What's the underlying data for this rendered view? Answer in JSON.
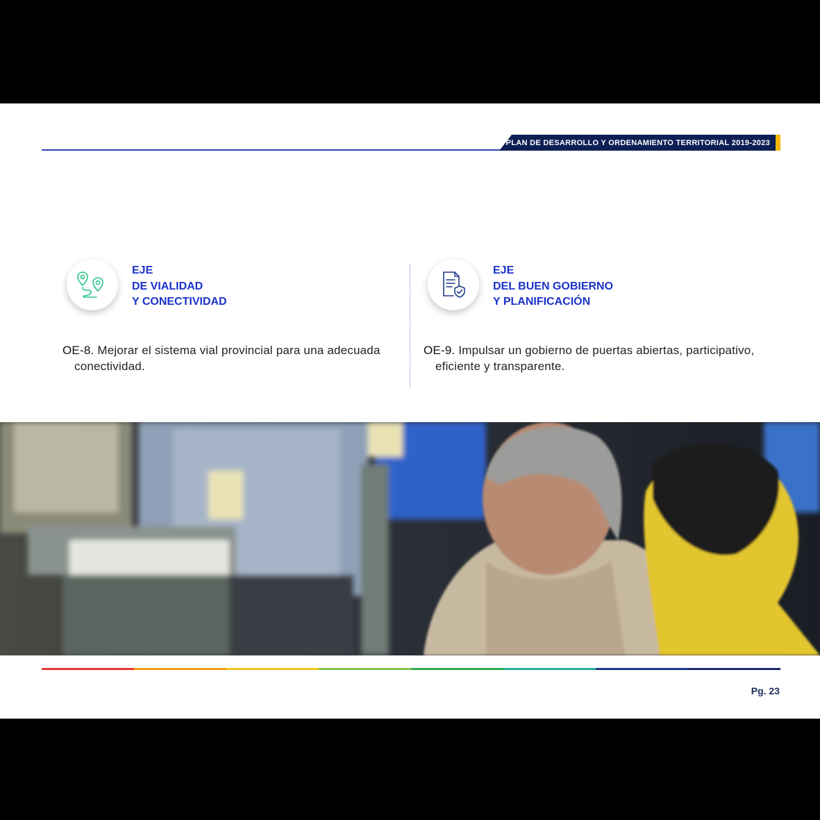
{
  "header": {
    "title": "PLAN DE DESARROLLO Y ORDENAMIENTO TERRITORIAL 2019-2023",
    "banner_color": "#0e1f55",
    "accent_color": "#f2b705",
    "line_color": "#2a46b8"
  },
  "axes": [
    {
      "icon": "map-route-icon",
      "title_lines": [
        "EJE",
        "DE VIALIDAD",
        "Y CONECTIVIDAD"
      ],
      "objective_code": "OE-8.",
      "objective_text": " Mejorar el sistema vial provincial para una adecuada conectividad."
    },
    {
      "icon": "document-shield-icon",
      "title_lines": [
        "EJE",
        "DEL BUEN GOBIERNO",
        "Y PLANIFICACIÓN"
      ],
      "objective_code": "OE-9.",
      "objective_text": " Impulsar un gobierno de puertas abiertas, participativo, eficiente y transparente."
    }
  ],
  "title_color": "#1b33c9",
  "footer": {
    "page_label": "Pg. 23",
    "line_colors": [
      "#e53935",
      "#f39c12",
      "#f5c518",
      "#8bc34a",
      "#2eaa4f",
      "#2bb3a0",
      "#1e3a8a",
      "#1b2a6b"
    ]
  }
}
